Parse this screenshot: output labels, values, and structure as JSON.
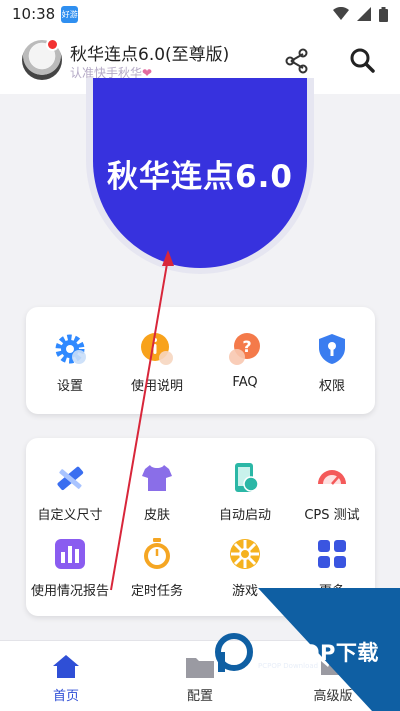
{
  "status_bar": {
    "time": "10:38",
    "app_badge": "好游"
  },
  "header": {
    "title": "秋华连点6.0(至尊版)",
    "subtitle": "认准快手秋华",
    "subtitle_heart": "❤"
  },
  "hero": {
    "text": "秋华连点6.0"
  },
  "quick_menu": [
    {
      "label": "设置",
      "icon": "gear-icon"
    },
    {
      "label": "使用说明",
      "icon": "info-icon"
    },
    {
      "label": "FAQ",
      "icon": "question-icon"
    },
    {
      "label": "权限",
      "icon": "shield-key-icon"
    }
  ],
  "tools_menu": [
    {
      "label": "自定义尺寸",
      "icon": "ruler-pencil-icon"
    },
    {
      "label": "皮肤",
      "icon": "tshirt-icon"
    },
    {
      "label": "自动启动",
      "icon": "phone-auto-icon"
    },
    {
      "label": "CPS 测试",
      "icon": "speedometer-icon"
    },
    {
      "label": "使用情况报告",
      "icon": "bar-chart-icon"
    },
    {
      "label": "定时任务",
      "icon": "stopwatch-icon"
    },
    {
      "label": "游戏",
      "icon": "game-wheel-icon"
    },
    {
      "label": "更多",
      "icon": "grid-icon"
    }
  ],
  "bottom_nav": [
    {
      "label": "首页",
      "icon": "home-icon",
      "active": true
    },
    {
      "label": "配置",
      "icon": "folder-icon",
      "active": false
    },
    {
      "label": "高级版",
      "icon": "crown-icon",
      "active": false
    }
  ],
  "watermark": {
    "text": "PCPOP下载",
    "sub": "PCPOP Download"
  },
  "colors": {
    "primary": "#3732de",
    "nav_active": "#2f4fd6",
    "annotation_arrow": "#d8263a",
    "watermark_blue": "#0f5fa3"
  }
}
